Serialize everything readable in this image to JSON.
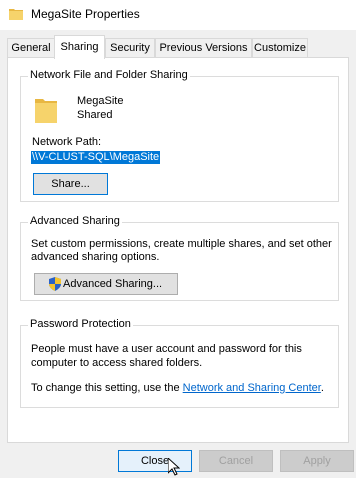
{
  "window": {
    "title": "MegaSite Properties",
    "folder_icon": "folder-icon"
  },
  "tabs": [
    {
      "label": "General"
    },
    {
      "label": "Sharing"
    },
    {
      "label": "Security"
    },
    {
      "label": "Previous Versions"
    },
    {
      "label": "Customize"
    }
  ],
  "network_sharing": {
    "group_title": "Network File and Folder Sharing",
    "folder_name": "MegaSite",
    "status": "Shared",
    "path_label": "Network Path:",
    "path_value": "\\\\V-CLUST-SQL\\MegaSite",
    "share_button": "Share..."
  },
  "advanced_sharing": {
    "group_title": "Advanced Sharing",
    "description": "Set custom permissions, create multiple shares, and set other advanced sharing options.",
    "description_line1": "Set custom permissions, create multiple shares, and set other",
    "description_line2": "advanced sharing options.",
    "button": "Advanced Sharing..."
  },
  "password_protection": {
    "group_title": "Password Protection",
    "line1": "People must have a user account and password for this",
    "line2": "computer to access shared folders.",
    "change_prefix": "To change this setting, use the ",
    "link_text": "Network and Sharing Center",
    "change_suffix": "."
  },
  "footer": {
    "close": "Close",
    "cancel": "Cancel",
    "apply": "Apply"
  },
  "colors": {
    "accent": "#0078d7",
    "link": "#0066cc",
    "folder": "#f3cc5f"
  }
}
